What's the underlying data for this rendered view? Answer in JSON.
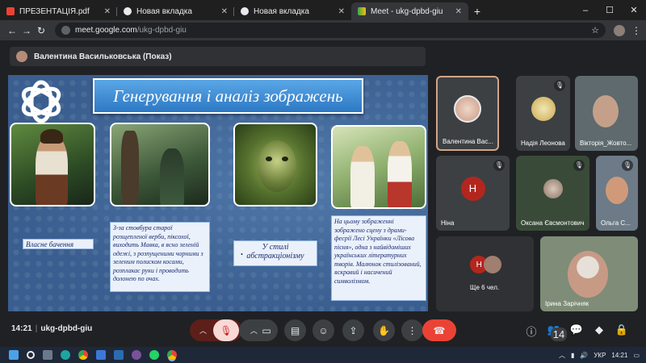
{
  "browser": {
    "tabs": [
      {
        "title": "ПРЕЗЕНТАЦІЯ.pdf",
        "icon": "pdf-icon",
        "active": false
      },
      {
        "title": "Новая вкладка",
        "icon": "chrome-icon",
        "active": false
      },
      {
        "title": "Новая вкладка",
        "icon": "chrome-icon",
        "active": false
      },
      {
        "title": "Meet - ukg-dpbd-giu",
        "icon": "meet-icon",
        "active": true
      }
    ],
    "url_host": "meet.google.com",
    "url_path": "/ukg-dpbd-giu",
    "window_controls": [
      "–",
      "☐",
      "✕"
    ]
  },
  "meet": {
    "presenter_label": "Валентина Васильковська (Показ)",
    "meeting_time": "14:21",
    "meeting_code": "ukg-dpbd-giu",
    "participants_count": "14"
  },
  "slide": {
    "title": "Генерування і аналіз зображень",
    "box1": "Власне бачення",
    "box2": "З-за стовбура старої розщепленої верби, піксохої, виходить Мавка, в ясно зеленій одежі, з розпущеними чорними з зеленим полиском косами, розплакає руки і проводить долонею по очах.",
    "box3": "У стилі абстракціонізму",
    "box4": "На цьому зображенні зображено сцену з драми-феєрії Лесі Українки «Лісова пісня», одна з найвідоміших українських літературних творів. Малюнок стилізований, яскравий і насичений символізмом."
  },
  "tiles": [
    {
      "name": "Валентина Вас...",
      "muted": false
    },
    {
      "name": "Надія Леонова",
      "muted": true
    },
    {
      "name": "Вікторія_Жовто...",
      "muted": true
    },
    {
      "name": "Ніна",
      "muted": true,
      "initial": "Н"
    },
    {
      "name": "Оксана Євсмонтович",
      "muted": true
    },
    {
      "name": "Ольга С...",
      "muted": true
    },
    {
      "name": "Ще 6 чел.",
      "initial": "Н"
    },
    {
      "name": "Ірина Зарічняк",
      "muted": false
    }
  ],
  "taskbar": {
    "lang": "УКР",
    "time": "14:21"
  },
  "colors": {
    "accent_red": "#ea4335",
    "meet_bg": "#202124",
    "slide_bg": "#3a5e8f"
  }
}
